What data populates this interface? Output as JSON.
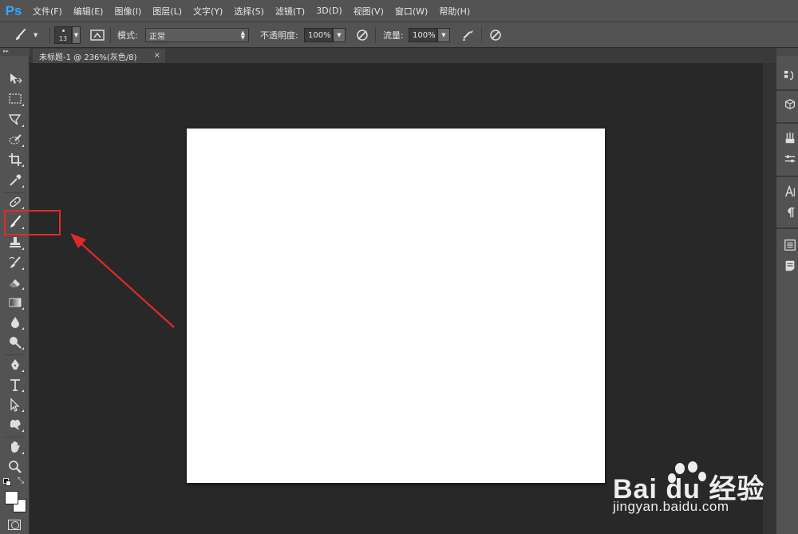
{
  "app": {
    "logo": "Ps"
  },
  "menu": [
    "文件(F)",
    "编辑(E)",
    "图像(I)",
    "图层(L)",
    "文字(Y)",
    "选择(S)",
    "滤镜(T)",
    "3D(D)",
    "视图(V)",
    "窗口(W)",
    "帮助(H)"
  ],
  "options": {
    "brush_size": "13",
    "mode_label": "模式:",
    "mode_value": "正常",
    "opacity_label": "不透明度:",
    "opacity_value": "100%",
    "flow_label": "流量:",
    "flow_value": "100%"
  },
  "document": {
    "tab_title": "未标题-1 @ 236%(灰色/8)",
    "close_glyph": "×"
  },
  "toolbar": {
    "tools": [
      "move-tool",
      "marquee-tool",
      "lasso-tool",
      "quick-select-tool",
      "crop-tool",
      "eyedropper-tool",
      "healing-brush-tool",
      "brush-tool",
      "clone-stamp-tool",
      "history-brush-tool",
      "eraser-tool",
      "gradient-tool",
      "blur-tool",
      "dodge-tool",
      "pen-tool",
      "type-tool",
      "path-select-tool",
      "shape-tool",
      "hand-tool",
      "zoom-tool"
    ],
    "selected_tool": "brush-tool",
    "foreground_color": "#ffffff",
    "background_color": "#ffffff"
  },
  "annotation": {
    "highlight_color": "#e02a2a"
  },
  "watermark": {
    "main": "Bai du 经验",
    "sub": "jingyan.baidu.com"
  }
}
